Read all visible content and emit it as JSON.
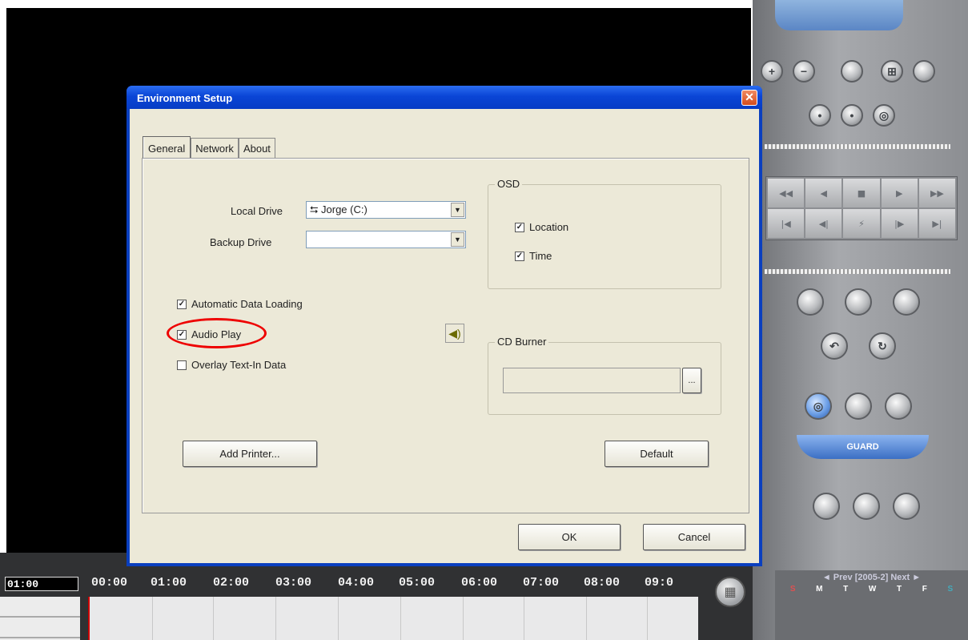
{
  "dialog": {
    "title": "Environment Setup",
    "close_glyph": "✕"
  },
  "tabs": [
    {
      "label": "General",
      "active": true
    },
    {
      "label": "Network",
      "active": false
    },
    {
      "label": "About",
      "active": false
    }
  ],
  "general": {
    "local_drive_label": "Local Drive",
    "local_drive_value": "⮀ Jorge (C:)",
    "backup_drive_label": "Backup Drive",
    "backup_drive_value": "",
    "automatic_data_loading": {
      "label": "Automatic Data Loading",
      "checked": true
    },
    "audio_play": {
      "label": "Audio Play",
      "checked": true
    },
    "overlay_text_in_data": {
      "label": "Overlay Text-In Data",
      "checked": false
    },
    "osd": {
      "title": "OSD",
      "location": {
        "label": "Location",
        "checked": true
      },
      "time": {
        "label": "Time",
        "checked": true
      }
    },
    "cd_burner": {
      "title": "CD Burner",
      "value": "",
      "browse_label": "..."
    },
    "add_printer_label": "Add Printer...",
    "default_label": "Default"
  },
  "footer": {
    "ok_label": "OK",
    "cancel_label": "Cancel"
  },
  "timeline": {
    "current_time": "01:00",
    "hours": [
      "00:00",
      "01:00",
      "02:00",
      "03:00",
      "04:00",
      "05:00",
      "06:00",
      "07:00",
      "08:00",
      "09:0"
    ]
  },
  "right_panel": {
    "guard_label": "GUARD",
    "calendar": {
      "header": "◄ Prev [2005-2] Next ►",
      "days": [
        "S",
        "M",
        "T",
        "W",
        "T",
        "F",
        "S"
      ]
    }
  },
  "colors": {
    "titlebar": "#0a45d6",
    "dialog_bg": "#ece9d8",
    "annotation": "#e00000"
  }
}
